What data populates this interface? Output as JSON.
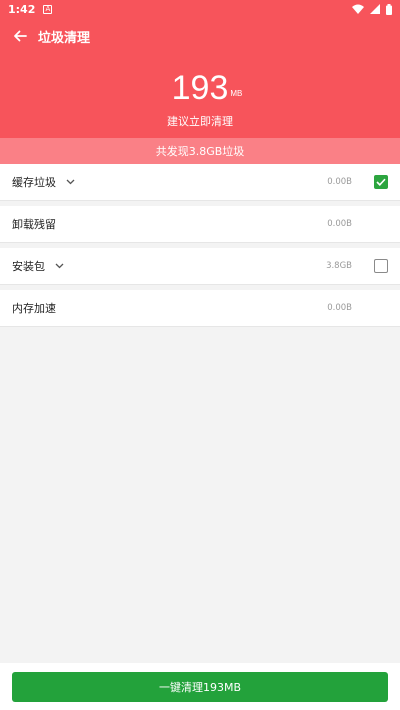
{
  "status": {
    "time": "1:42",
    "notif_icon": "A"
  },
  "toolbar": {
    "title": "垃圾清理"
  },
  "summary": {
    "size": "193",
    "unit": "MB",
    "suggestion": "建议立即清理",
    "found": "共发现3.8GB垃圾"
  },
  "items": [
    {
      "label": "缓存垃圾",
      "size": "0.00B",
      "expandable": true,
      "checked": true
    },
    {
      "label": "卸载残留",
      "size": "0.00B",
      "expandable": false,
      "checked": null
    },
    {
      "label": "安装包",
      "size": "3.8GB",
      "expandable": true,
      "checked": false
    },
    {
      "label": "内存加速",
      "size": "0.00B",
      "expandable": false,
      "checked": null
    }
  ],
  "action": {
    "clean_label": "一键清理193MB"
  },
  "colors": {
    "header": "#f7545b",
    "found_bar": "#fa8086",
    "accent_green": "#23a23b"
  }
}
